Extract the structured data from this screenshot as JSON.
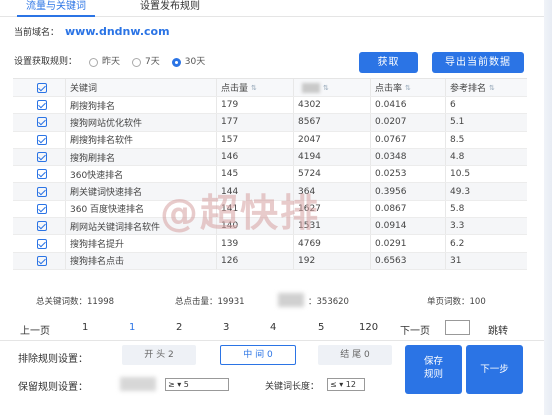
{
  "tabs": [
    "流量与关键词",
    "设置发布规则"
  ],
  "domain": {
    "label": "当前域名：",
    "value": "www.dndnw.com"
  },
  "rule": {
    "label": "设置获取规则：",
    "options": [
      "昨天",
      "7天",
      "30天"
    ],
    "selected": "30天"
  },
  "buttons": {
    "fetch": "获取",
    "export": "导出当前数据"
  },
  "table": {
    "headers": [
      "关键词",
      "点击量",
      "",
      "点击率",
      "参考排名"
    ],
    "rows": [
      {
        "keyword": "刷搜狗排名",
        "clicks": "179",
        "impressions": "4302",
        "ctr": "0.0416",
        "rank": "6"
      },
      {
        "keyword": "搜狗网站优化软件",
        "clicks": "177",
        "impressions": "8567",
        "ctr": "0.0207",
        "rank": "5.1"
      },
      {
        "keyword": "刷搜狗排名软件",
        "clicks": "157",
        "impressions": "2047",
        "ctr": "0.0767",
        "rank": "8.5"
      },
      {
        "keyword": "搜狗刷排名",
        "clicks": "146",
        "impressions": "4194",
        "ctr": "0.0348",
        "rank": "4.8"
      },
      {
        "keyword": "360快速排名",
        "clicks": "145",
        "impressions": "5724",
        "ctr": "0.0253",
        "rank": "10.5"
      },
      {
        "keyword": "刷关键词快速排名",
        "clicks": "144",
        "impressions": "364",
        "ctr": "0.3956",
        "rank": "49.3"
      },
      {
        "keyword": "360 百度快速排名",
        "clicks": "141",
        "impressions": "1627",
        "ctr": "0.0867",
        "rank": "5.8"
      },
      {
        "keyword": "刷网站关键词排名软件",
        "clicks": "140",
        "impressions": "1531",
        "ctr": "0.0914",
        "rank": "3.3"
      },
      {
        "keyword": "搜狗排名提升",
        "clicks": "139",
        "impressions": "4769",
        "ctr": "0.0291",
        "rank": "6.2"
      },
      {
        "keyword": "搜狗排名点击",
        "clicks": "126",
        "impressions": "192",
        "ctr": "0.6563",
        "rank": "31"
      }
    ]
  },
  "totals": {
    "keywords": "总关键词数：11998",
    "clicks": "总点击量：19931",
    "impressions": "：353620",
    "page_keywords": "单页词数：100"
  },
  "pager": {
    "prev": "上一页",
    "pages": [
      "1",
      "1",
      "2",
      "3",
      "4",
      "5",
      "120"
    ],
    "current_index": 1,
    "next": "下一页",
    "jump": "跳转"
  },
  "exclude": {
    "label": "排除规则设置：",
    "options": [
      "开 头 2",
      "中 间 0",
      "结 尾 0"
    ],
    "selected_index": 1
  },
  "keep": {
    "label": "保留规则设置：",
    "select_value": "≥ ▾ 5",
    "length_label": "关键词长度：",
    "length_select": "≤ ▾ 12"
  },
  "actions": {
    "save": "保存规则",
    "next": "下一步"
  },
  "watermark": "@超快排",
  "colors": {
    "accent": "#2b74e5"
  }
}
